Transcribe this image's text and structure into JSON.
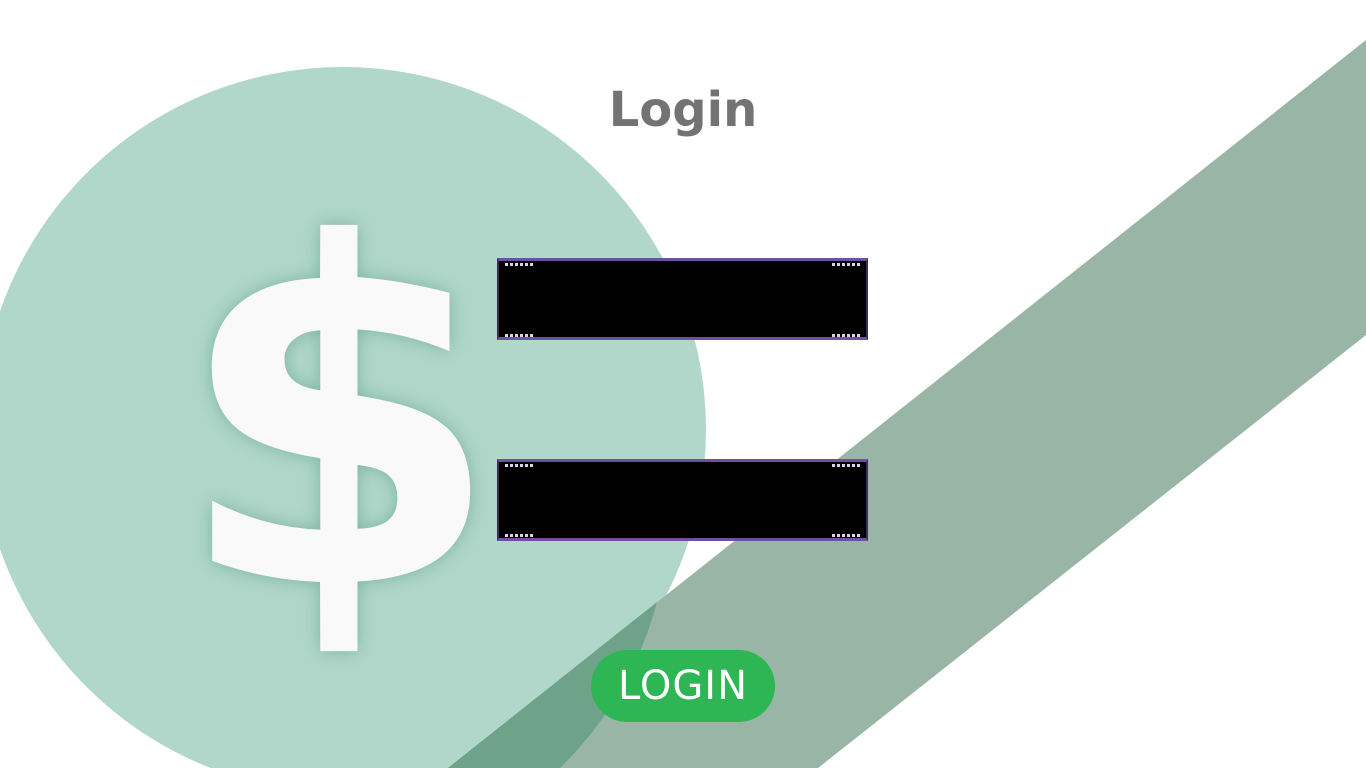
{
  "page": {
    "title": "Login"
  },
  "decor": {
    "currency_symbol": "$",
    "icon": "dollar-sign-icon"
  },
  "form": {
    "username": {
      "value": "",
      "placeholder": ""
    },
    "password": {
      "value": "",
      "placeholder": ""
    },
    "submit_label": "LOGIN"
  },
  "colors": {
    "circle": "#b0d7ca",
    "band": "#99b5a6",
    "title": "#737373",
    "field_bg": "#000000",
    "field_border": "#6e4fa0",
    "button": "#2db653",
    "button_text": "#ffffff"
  }
}
